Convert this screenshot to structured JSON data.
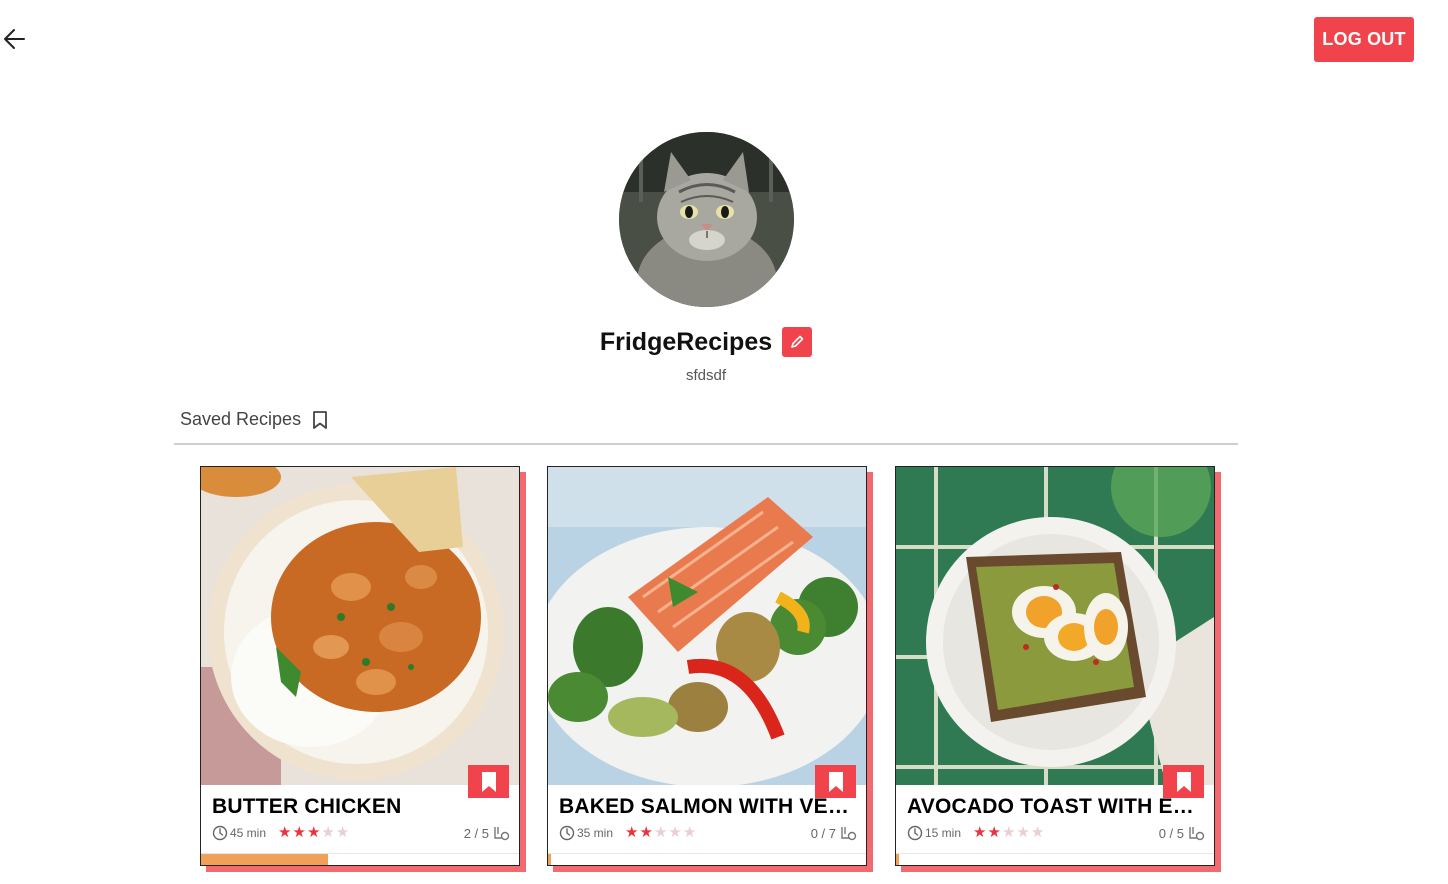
{
  "header": {
    "back_icon": "arrow-left-icon",
    "logout_label": "LOG OUT",
    "accent_color": "#f0434b"
  },
  "profile": {
    "avatar_alt": "tabby cat",
    "username": "FridgeRecipes",
    "edit_icon": "pencil-icon",
    "subtitle": "sfdsdf"
  },
  "tabs": {
    "saved_label": "Saved Recipes",
    "saved_icon": "bookmark-outline-icon"
  },
  "recipes": [
    {
      "title": "BUTTER CHICKEN",
      "time": "45 min",
      "rating": 3,
      "rating_max": 5,
      "ingredients": "2 / 5",
      "progress": 0.4,
      "image": "butter-chicken"
    },
    {
      "title": "BAKED SALMON WITH VEG...",
      "time": "35 min",
      "rating": 2,
      "rating_max": 5,
      "ingredients": "0 / 7",
      "progress": 0,
      "image": "baked-salmon"
    },
    {
      "title": "AVOCADO TOAST WITH EGG",
      "time": "15 min",
      "rating": 2,
      "rating_max": 5,
      "ingredients": "0 / 5",
      "progress": 0,
      "image": "avocado-toast"
    }
  ]
}
